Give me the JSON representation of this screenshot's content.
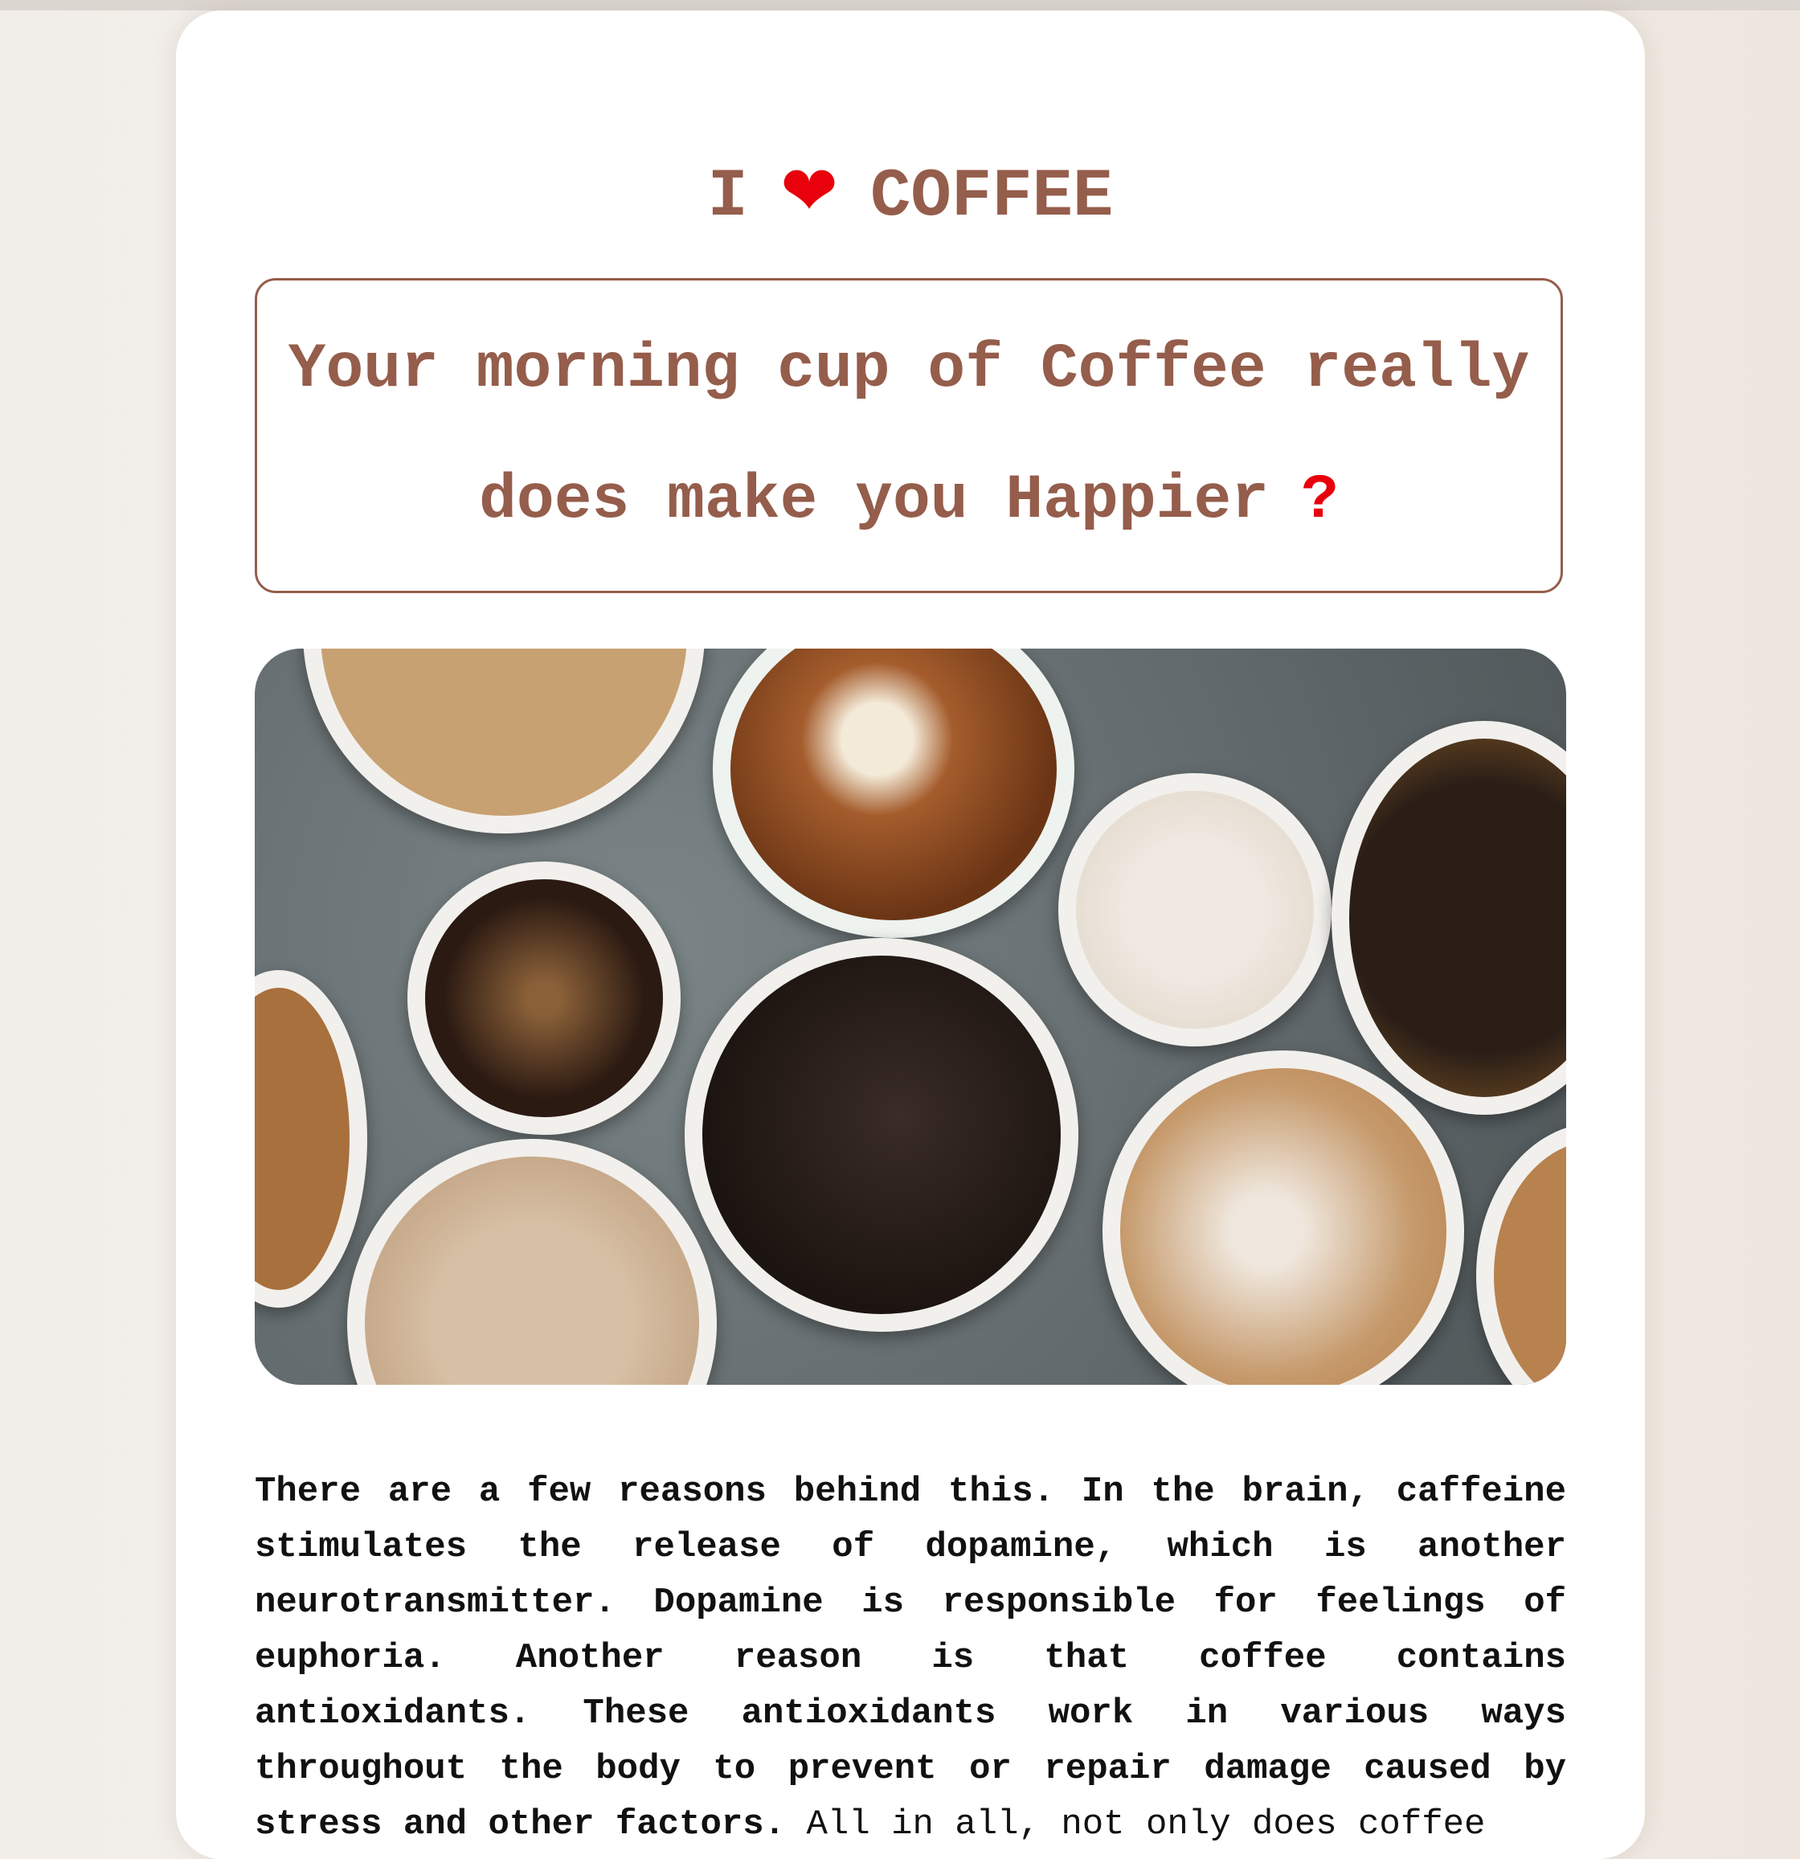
{
  "header": {
    "title_prefix": "I",
    "heart_icon": "❤",
    "title_suffix": "COFFEE"
  },
  "callout": {
    "text": "Your morning cup of Coffee really does make you Happier",
    "mark": "?"
  },
  "photo": {
    "alt": "coffee-cups-top-view"
  },
  "article": {
    "bold_text": "There are a few reasons behind this. In the brain, caffeine stimulates the release of dopamine, which is another neurotransmitter. Dopamine is responsible for feelings of euphoria. Another reason is that coffee contains antioxidants. These antioxidants work in various ways throughout the body to prevent or repair damage caused by stress and other factors.",
    "normal_text": "All in all, not only does coffee"
  },
  "colors": {
    "accent": "#955d4b",
    "heart": "#e8000c",
    "text": "#111111"
  }
}
